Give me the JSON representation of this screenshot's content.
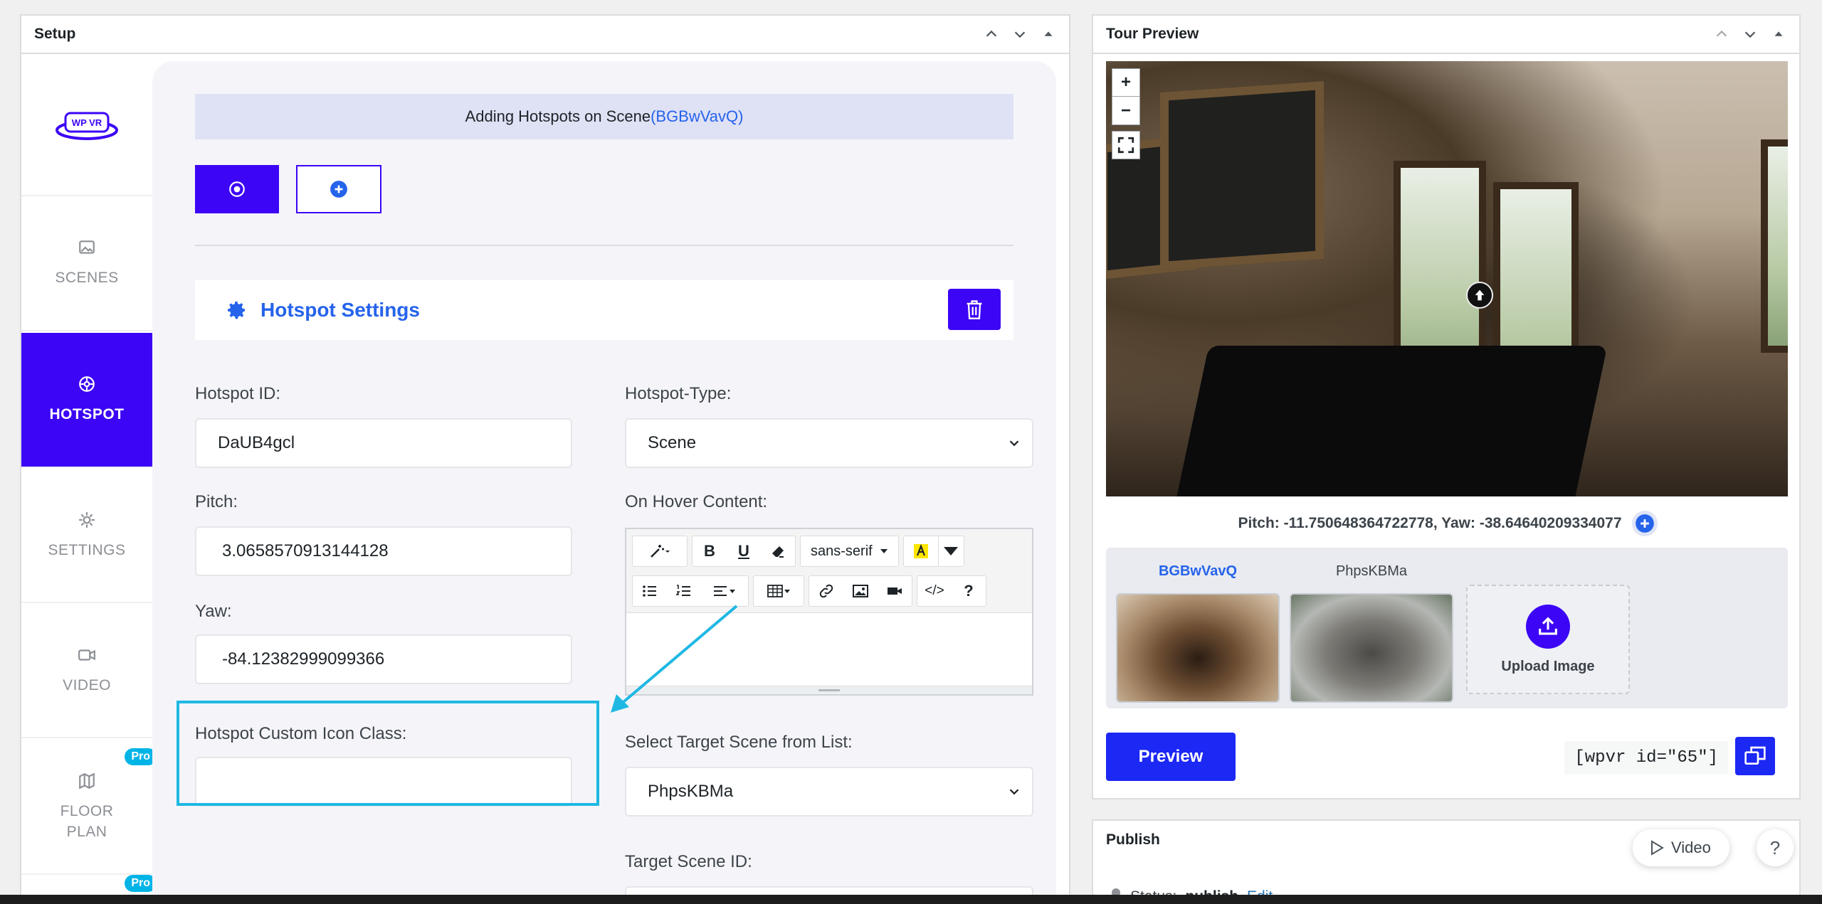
{
  "setup": {
    "title": "Setup",
    "logo_text": "WP VR",
    "sidebar": {
      "items": [
        {
          "label": "SCENES",
          "icon": "image-icon"
        },
        {
          "label": "HOTSPOT",
          "icon": "crosshair-icon"
        },
        {
          "label": "SETTINGS",
          "icon": "gear-icon"
        },
        {
          "label": "VIDEO",
          "icon": "video-icon"
        },
        {
          "label": "FLOOR PLAN",
          "icon": "map-icon"
        }
      ],
      "pro_label": "Pro"
    },
    "banner": {
      "prefix": "Adding Hotspots on Scene",
      "scene": "(BGBwVavQ)"
    },
    "hotspot_settings_title": "Hotspot Settings",
    "fields": {
      "hotspot_id_label": "Hotspot ID:",
      "hotspot_id_value": "DaUB4gcl",
      "hotspot_type_label": "Hotspot-Type:",
      "hotspot_type_value": "Scene",
      "pitch_label": "Pitch:",
      "pitch_value": "3.0658570913144128",
      "on_hover_label": "On Hover Content:",
      "yaw_label": "Yaw:",
      "yaw_value": "-84.12382999099366",
      "custom_icon_label": "Hotspot Custom Icon Class:",
      "custom_icon_value": "",
      "target_scene_label": "Select Target Scene from List:",
      "target_scene_value": "PhpsKBMa",
      "target_scene_id_label": "Target Scene ID:"
    },
    "editor": {
      "font_select": "sans-serif",
      "bold": "B",
      "underline": "U",
      "code": "</>",
      "help": "?"
    }
  },
  "tour_preview": {
    "title": "Tour Preview",
    "zoom_in": "+",
    "zoom_out": "−",
    "coords": "Pitch: -11.750648364722778, Yaw: -38.64640209334077",
    "scenes": [
      {
        "name": "BGBwVavQ",
        "active": true
      },
      {
        "name": "PhpsKBMa",
        "active": false
      }
    ],
    "upload_label": "Upload Image",
    "preview_button": "Preview",
    "shortcode": "[wpvr id=\"65\"]"
  },
  "publish": {
    "title": "Publish",
    "status_prefix": "Status:",
    "status_value": "publish",
    "status_edit": "Edit"
  },
  "floating": {
    "video_label": "Video",
    "help_label": "?"
  },
  "colors": {
    "primary": "#3c05f5",
    "accent_blue": "#2563eb",
    "highlight": "#1fb8e3",
    "pro_badge": "#00b4e6"
  }
}
